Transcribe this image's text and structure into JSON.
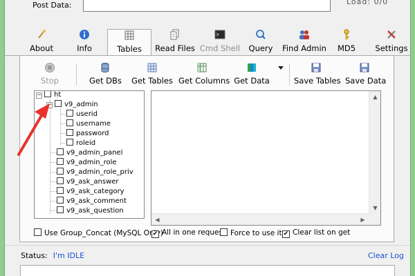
{
  "top": {
    "post_data_label": "Post Data:",
    "post_data_value": "",
    "clipped_text": "Load: 0/0"
  },
  "tabs": [
    {
      "label": "About",
      "icon": "wand-icon"
    },
    {
      "label": "Info",
      "icon": "info-icon"
    },
    {
      "label": "Tables",
      "icon": "table-icon",
      "active": true
    },
    {
      "label": "Read Files",
      "icon": "files-icon"
    },
    {
      "label": "Cmd Shell",
      "icon": "terminal-icon",
      "disabled": true
    },
    {
      "label": "Query",
      "icon": "query-icon"
    },
    {
      "label": "Find Admin",
      "icon": "users-icon"
    },
    {
      "label": "MD5",
      "icon": "key-icon"
    },
    {
      "label": "Settings",
      "icon": "tools-icon"
    }
  ],
  "toolbar": {
    "stop": "Stop",
    "get_dbs": "Get DBs",
    "get_tables": "Get Tables",
    "get_columns": "Get Columns",
    "get_data": "Get Data",
    "save_tables": "Save Tables",
    "save_data": "Save Data"
  },
  "tree": {
    "root": "ht",
    "table": "v9_admin",
    "columns": [
      "userid",
      "username",
      "password",
      "roleid"
    ],
    "other_tables": [
      "v9_admin_panel",
      "v9_admin_role",
      "v9_admin_role_priv",
      "v9_ask_answer",
      "v9_ask_category",
      "v9_ask_comment",
      "v9_ask_question"
    ]
  },
  "options": {
    "group_concat": "Use Group_Concat (MySQL Only)",
    "group_concat_checked": false,
    "all_in_one": "All in one request.",
    "all_in_one_checked": true,
    "force": "Force to use it",
    "force_checked": false,
    "clear_list": "Clear list on get",
    "clear_list_checked": true
  },
  "status": {
    "label": "Status:",
    "value": "I'm IDLE",
    "clear_log": "Clear Log"
  },
  "colors": {
    "link": "#1a4fd6",
    "arrow": "#e8322b",
    "frame": "#8fce8f"
  }
}
